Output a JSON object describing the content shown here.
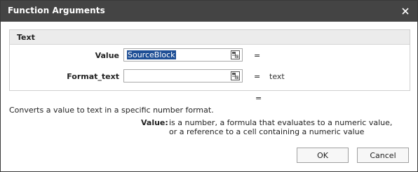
{
  "dialog": {
    "title": "Function Arguments"
  },
  "group": {
    "title": "Text",
    "arguments": [
      {
        "label": "Value",
        "value": "SourceBlock",
        "equals": "=",
        "evaluated": ""
      },
      {
        "label": "Format_text",
        "value": "",
        "equals": "=",
        "evaluated": "text"
      }
    ]
  },
  "result": {
    "equals": "="
  },
  "description": "Converts a value to text in a specific number format.",
  "argument_help": {
    "label": "Value:",
    "text": "is a number, a formula that evaluates to a numeric value, or a reference to a cell containing a numeric value"
  },
  "buttons": {
    "ok": "OK",
    "cancel": "Cancel"
  },
  "icons": {
    "close": "close-icon",
    "range_picker": "cell-range-picker-icon"
  },
  "colors": {
    "titlebar": "#444444",
    "selection": "#1e4f96"
  }
}
